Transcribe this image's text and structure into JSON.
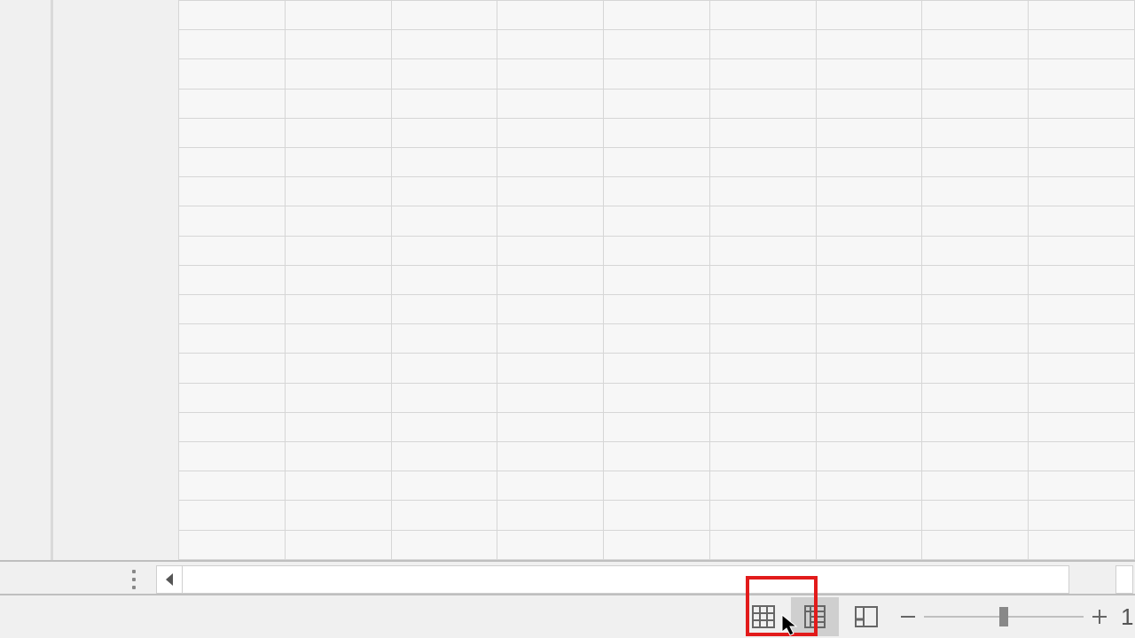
{
  "grid": {
    "rows": 19,
    "cols": 9
  },
  "statusbar": {
    "view_normal": "normal-view-icon",
    "view_page_layout": "page-layout-view-icon",
    "view_page_break": "page-break-preview-icon",
    "zoom_value": "1"
  },
  "highlight": {
    "target": "page-layout-view-button"
  }
}
